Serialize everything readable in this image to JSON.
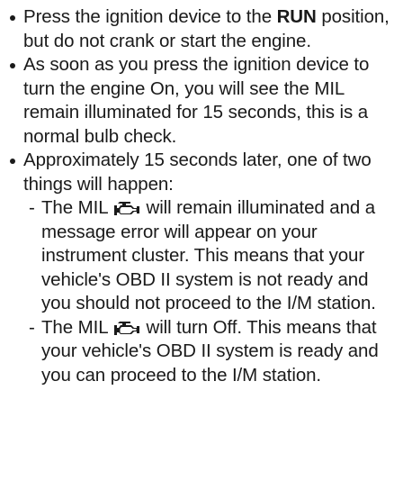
{
  "bullets": {
    "b1": {
      "pre": "Press the ignition device to the ",
      "bold": "RUN",
      "post": " position, but do not crank or start the engine."
    },
    "b2": {
      "text": "As soon as you press the ignition device to turn the engine On, you will see the MIL remain illuminated for 15 seconds, this is a normal bulb check."
    },
    "b3": {
      "text": "Approximately 15 seconds later, one of two things will happen:"
    }
  },
  "sub_items": {
    "s1": {
      "dash": "-",
      "pre": "The MIL",
      "post": "will remain illuminated and a message error will appear on your instrument cluster. This means that your vehicle's OBD II system is not ready and you should not proceed to the I/M station."
    },
    "s2": {
      "dash": "-",
      "pre": "The MIL",
      "post": "will turn Off. This means that your vehicle's OBD II system is ready and you can proceed to the I/M station."
    }
  },
  "icons": {
    "mil": "check-engine-icon",
    "mil_color": "#1a1a1a"
  }
}
